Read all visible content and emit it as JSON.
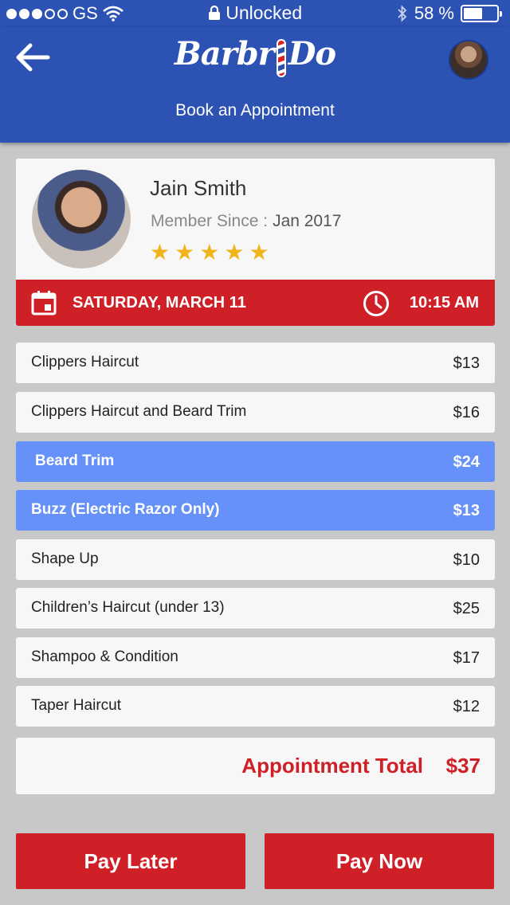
{
  "status_bar": {
    "carrier": "GS",
    "lock_text": "Unlocked",
    "battery_percent": "58 %",
    "battery_level": 0.58,
    "signal_bars": 3,
    "signal_total": 5
  },
  "header": {
    "logo_part1": "Barbr",
    "logo_part2": "Do",
    "title": "Book an Appointment"
  },
  "barber": {
    "name": "Jain Smith",
    "member_since_label": "Member Since :",
    "member_since_value": "Jan 2017",
    "rating": 5
  },
  "appointment": {
    "date": "SATURDAY, MARCH 11",
    "time": "10:15 AM"
  },
  "services": [
    {
      "name": "Clippers Haircut",
      "price": "$13",
      "selected": false
    },
    {
      "name": "Clippers Haircut and Beard Trim",
      "price": "$16",
      "selected": false
    },
    {
      "name": "Beard Trim",
      "price": "$24",
      "selected": true
    },
    {
      "name": "Buzz (Electric Razor Only)",
      "price": "$13",
      "selected": true
    },
    {
      "name": "Shape Up",
      "price": "$10",
      "selected": false
    },
    {
      "name": "Children’s Haircut (under 13)",
      "price": "$25",
      "selected": false
    },
    {
      "name": "Shampoo & Condition",
      "price": "$17",
      "selected": false
    },
    {
      "name": "Taper Haircut",
      "price": "$12",
      "selected": false
    }
  ],
  "total": {
    "label": "Appointment Total",
    "value": "$37"
  },
  "actions": {
    "pay_later": "Pay Later",
    "pay_now": "Pay Now"
  },
  "colors": {
    "header_blue": "#2c52b4",
    "accent_red": "#cf2027",
    "selected_blue": "#6691f8",
    "star_gold": "#f0b41c"
  },
  "icons": {
    "back": "arrow-left-icon",
    "calendar": "calendar-icon",
    "clock": "clock-icon",
    "star": "star-icon",
    "wifi": "wifi-icon",
    "lock": "lock-icon",
    "bluetooth": "bluetooth-icon",
    "battery": "battery-icon"
  }
}
